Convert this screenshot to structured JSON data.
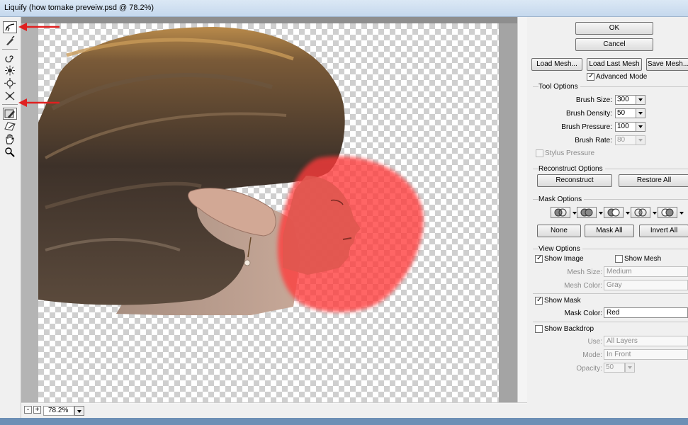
{
  "window": {
    "title": "Liquify (how tomake preveiw.psd @ 78.2%)"
  },
  "toolbar": {
    "tools": [
      "forward-warp-tool-icon",
      "reconstruct-tool-icon",
      "twirl-clockwise-tool-icon",
      "pucker-tool-icon",
      "bloat-tool-icon",
      "push-left-tool-icon",
      "freeze-mask-tool-icon",
      "thaw-mask-tool-icon",
      "hand-tool-icon",
      "zoom-tool-icon"
    ]
  },
  "zoom": {
    "value": "78.2%",
    "minus": "-",
    "plus": "+"
  },
  "buttons": {
    "ok": "OK",
    "cancel": "Cancel",
    "load_mesh": "Load Mesh...",
    "load_last_mesh": "Load Last Mesh",
    "save_mesh": "Save Mesh...",
    "reconstruct": "Reconstruct",
    "restore_all": "Restore All",
    "none": "None",
    "mask_all": "Mask All",
    "invert_all": "Invert All"
  },
  "advanced_mode": "Advanced Mode",
  "tool_options": {
    "title": "Tool Options",
    "brush_size_label": "Brush Size:",
    "brush_size": "300",
    "brush_density_label": "Brush Density:",
    "brush_density": "50",
    "brush_pressure_label": "Brush Pressure:",
    "brush_pressure": "100",
    "brush_rate_label": "Brush Rate:",
    "brush_rate": "80",
    "stylus_pressure": "Stylus Pressure"
  },
  "reconstruct_options": {
    "title": "Reconstruct Options"
  },
  "mask_options": {
    "title": "Mask Options"
  },
  "view_options": {
    "title": "View Options",
    "show_image": "Show Image",
    "show_mesh": "Show Mesh",
    "mesh_size_label": "Mesh Size:",
    "mesh_size": "Medium",
    "mesh_color_label": "Mesh Color:",
    "mesh_color": "Gray",
    "show_mask": "Show Mask",
    "mask_color_label": "Mask Color:",
    "mask_color": "Red",
    "show_backdrop": "Show Backdrop",
    "use_label": "Use:",
    "use": "All Layers",
    "mode_label": "Mode:",
    "mode": "In Front",
    "opacity_label": "Opacity:",
    "opacity": "50"
  },
  "colors": {
    "mask": "#ff3b3b",
    "annotation_arrow": "#e02020",
    "title_bar": "#c9dbef"
  }
}
